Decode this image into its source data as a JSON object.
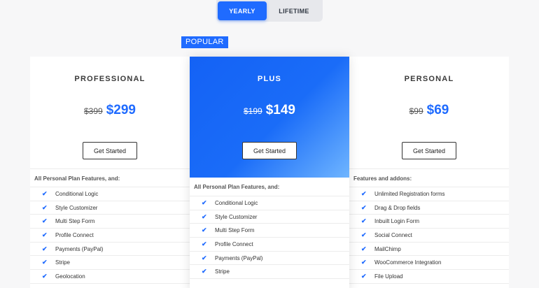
{
  "toggle": {
    "yearly": "YEARLY",
    "lifetime": "LIFETIME"
  },
  "badge": "POPULAR",
  "plans": [
    {
      "name": "PROFESSIONAL",
      "old_price": "$399",
      "price": "$299",
      "cta": "Get Started",
      "intro": "All Personal Plan Features, and:",
      "features": [
        "Conditional Logic",
        "Style Customizer",
        "Multi Step Form",
        "Profile Connect",
        "Payments (PayPal)",
        "Stripe",
        "Geolocation"
      ]
    },
    {
      "name": "PLUS",
      "old_price": "$199",
      "price": "$149",
      "cta": "Get Started",
      "intro": "All Personal Plan Features, and:",
      "features": [
        "Conditional Logic",
        "Style Customizer",
        "Multi Step Form",
        "Profile Connect",
        "Payments (PayPal)",
        "Stripe"
      ]
    },
    {
      "name": "PERSONAL",
      "old_price": "$99",
      "price": "$69",
      "cta": "Get Started",
      "intro": "Features and addons:",
      "features": [
        "Unlimited Registration forms",
        "Drag & Drop fields",
        "Inbuilt Login Form",
        "Social Connect",
        "MailChimp",
        "WooCommerce Integration",
        "File Upload"
      ]
    }
  ],
  "colors": {
    "accent": "#1f6bff",
    "gradient_end": "#6fb5ff"
  },
  "icons": {
    "feature_check": "check-icon"
  }
}
